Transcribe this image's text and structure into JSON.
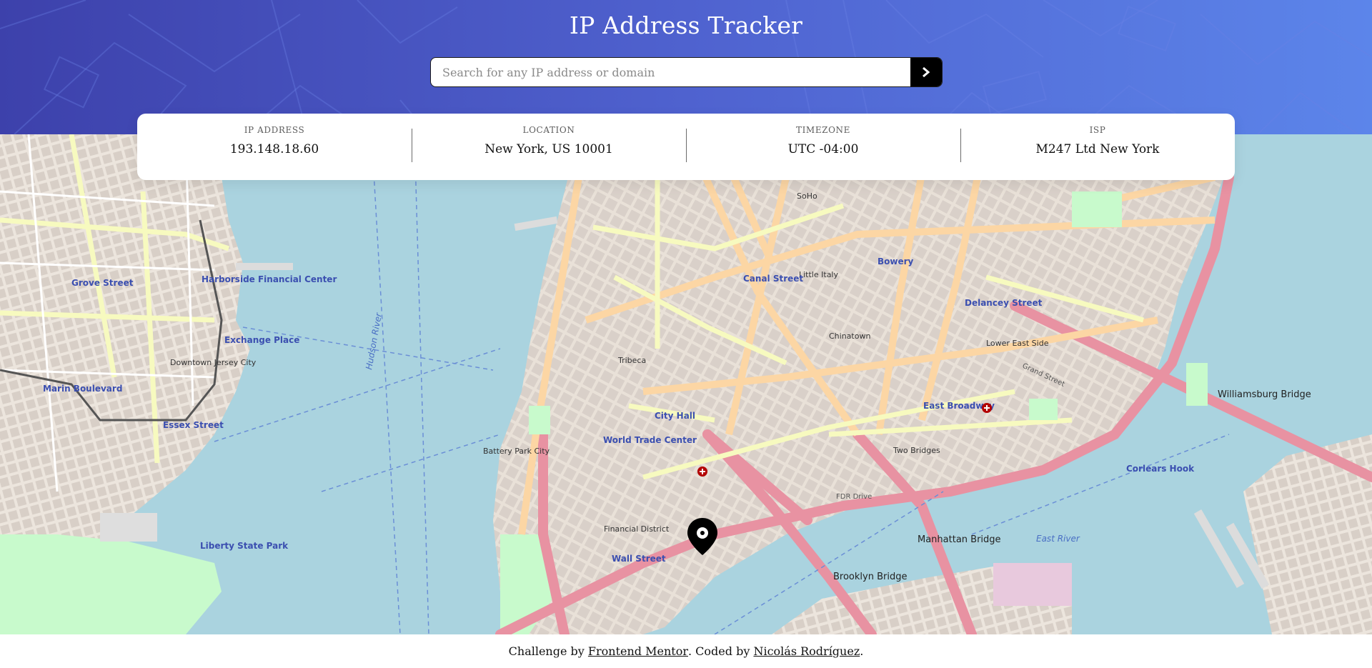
{
  "header": {
    "title": "IP Address Tracker"
  },
  "search": {
    "placeholder": "Search for any IP address or domain",
    "value": "",
    "button_icon": "chevron-right-icon"
  },
  "info": [
    {
      "label": "IP ADDRESS",
      "value": "193.148.18.60"
    },
    {
      "label": "LOCATION",
      "value": "New York, US 10001"
    },
    {
      "label": "TIMEZONE",
      "value": "UTC -04:00"
    },
    {
      "label": "ISP",
      "value": "M247 Ltd New York"
    }
  ],
  "map": {
    "marker_icon": "location-pin-icon",
    "labels": {
      "tribeca": "Tribeca",
      "chinatown": "Chinatown",
      "little_italy": "Little Italy",
      "financial_district": "Financial District",
      "lower_east_side": "Lower East Side",
      "soho": "SoHo",
      "bowery": "Bowery",
      "brooklyn_bridge": "Brooklyn Bridge",
      "manhattan_bridge": "Manhattan Bridge",
      "williamsburg_bridge": "Williamsburg Bridge",
      "exchange_place": "Exchange Place",
      "downtown_jersey_city": "Downtown Jersey City",
      "harborside": "Harborside Financial Center",
      "grove_street": "Grove Street",
      "marin_boulevard": "Marin Boulevard",
      "essex_street_jc": "Essex Street",
      "world_trade_center": "World Trade Center",
      "city_hall": "City Hall",
      "wall_street": "Wall Street",
      "hudson_river": "Hudson River",
      "east_river": "East River",
      "fdr_drive": "FDR Drive",
      "grand_street": "Grand Street",
      "east_broadway": "East Broadway",
      "delancey_street": "Delancey Street",
      "canal_street": "Canal Street",
      "battery_park_city": "Battery Park City",
      "liberty_state_park": "Liberty State Park",
      "corlears_hook": "Corlears Hook",
      "two_bridges": "Two Bridges"
    }
  },
  "footer": {
    "prefix": "Challenge by ",
    "link1": "Frontend Mentor",
    "middle": ". Coded by ",
    "link2": "Nicolás Rodríguez",
    "suffix": "."
  },
  "colors": {
    "header_start": "#3d41ab",
    "header_end": "#5c85ea",
    "water": "#aad3df",
    "land": "#efe9e1",
    "park": "#c8facc",
    "highway": "#e892a2",
    "primary_road": "#fcd6a4",
    "secondary_road": "#f7fabf",
    "marker": "#000000"
  }
}
